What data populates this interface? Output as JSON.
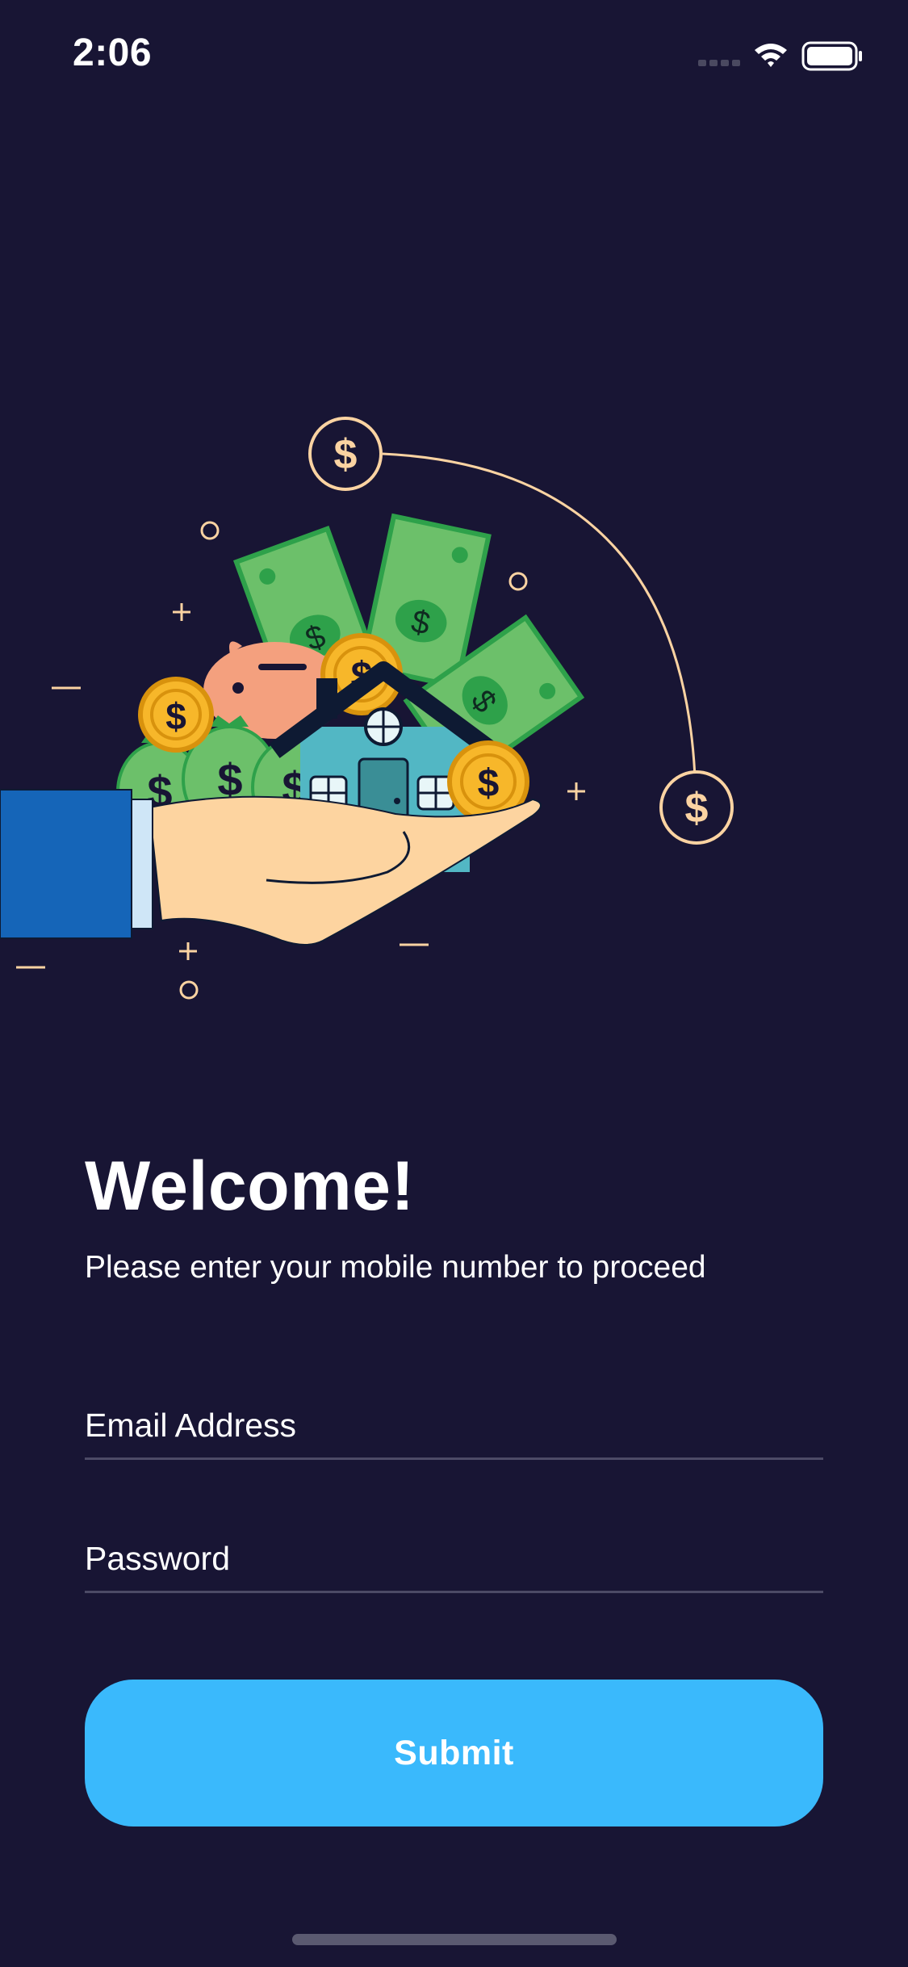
{
  "status_bar": {
    "time": "2:06",
    "icons": [
      "cellular-icon",
      "wifi-icon",
      "battery-icon"
    ]
  },
  "illustration": {
    "description_icon": "hand-holding-house-and-money-illustration",
    "colors": {
      "sleeve": "#1565b8",
      "hand": "#fdd4a0",
      "money": "#6cc06a",
      "money_dark": "#2ea14a",
      "coin": "#f7b72a",
      "house": "#52b7c4",
      "piggy": "#f4a07e",
      "accent_line": "#fbd3a2"
    }
  },
  "welcome": {
    "title": "Welcome!",
    "subtitle": "Please enter your mobile number to proceed"
  },
  "form": {
    "email_placeholder": "Email Address",
    "email_value": "",
    "password_placeholder": "Password",
    "password_value": ""
  },
  "submit": {
    "label": "Submit",
    "color": "#3ab9fc"
  },
  "background_color": "#181534"
}
